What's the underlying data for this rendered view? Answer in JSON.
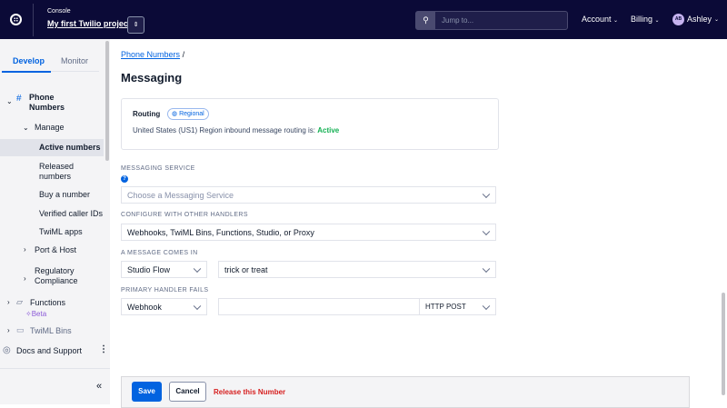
{
  "header": {
    "console_label": "Console",
    "project": "My first Twilio project",
    "search_placeholder": "Jump to...",
    "account": "Account",
    "billing": "Billing",
    "avatar_initials": "AB",
    "user": "Ashley"
  },
  "sidebar": {
    "tabs": [
      "Develop",
      "Monitor"
    ],
    "phone_numbers": "Phone Numbers",
    "manage": "Manage",
    "items": [
      "Active numbers",
      "Released numbers",
      "Buy a number",
      "Verified caller IDs",
      "TwiML apps"
    ],
    "port_host": "Port & Host",
    "regulatory": "Regulatory Compliance",
    "functions": "Functions",
    "beta": "Beta",
    "twiml_bins": "TwiML Bins",
    "docs": "Docs and Support"
  },
  "main": {
    "breadcrumb": "Phone Numbers",
    "breadcrumb_sep": "/",
    "title": "Messaging",
    "routing": {
      "title": "Routing",
      "badge": "Regional",
      "text": "United States (US1) Region inbound message routing is:",
      "status": "Active"
    },
    "messaging_service": {
      "label": "MESSAGING SERVICE",
      "placeholder": "Choose a Messaging Service"
    },
    "handlers": {
      "label": "CONFIGURE WITH OTHER HANDLERS",
      "value": "Webhooks, TwiML Bins, Functions, Studio, or Proxy"
    },
    "comes_in": {
      "label": "A MESSAGE COMES IN",
      "type": "Studio Flow",
      "value": "trick or treat"
    },
    "fails": {
      "label": "PRIMARY HANDLER FAILS",
      "type": "Webhook",
      "url": "",
      "method": "HTTP POST"
    },
    "footer": {
      "save": "Save",
      "cancel": "Cancel",
      "release": "Release this Number"
    }
  },
  "colors": {
    "header_bg": "#0b0a37",
    "primary": "#0263e0",
    "active": "#14b053",
    "danger": "#d61f1f",
    "beta": "#8c5bd8"
  }
}
